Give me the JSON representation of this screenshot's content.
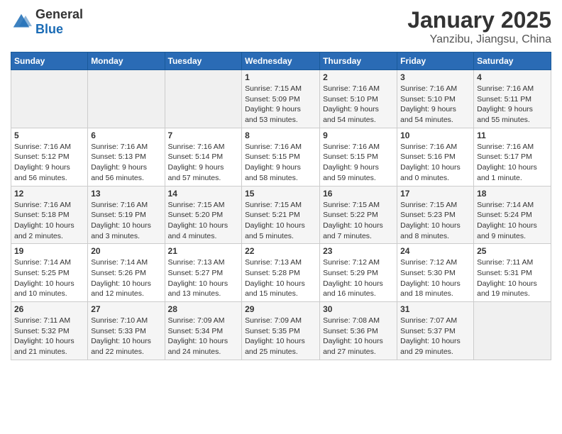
{
  "logo": {
    "general": "General",
    "blue": "Blue"
  },
  "title": "January 2025",
  "location": "Yanzibu, Jiangsu, China",
  "days_of_week": [
    "Sunday",
    "Monday",
    "Tuesday",
    "Wednesday",
    "Thursday",
    "Friday",
    "Saturday"
  ],
  "weeks": [
    [
      {
        "day": "",
        "info": ""
      },
      {
        "day": "",
        "info": ""
      },
      {
        "day": "",
        "info": ""
      },
      {
        "day": "1",
        "info": "Sunrise: 7:15 AM\nSunset: 5:09 PM\nDaylight: 9 hours\nand 53 minutes."
      },
      {
        "day": "2",
        "info": "Sunrise: 7:16 AM\nSunset: 5:10 PM\nDaylight: 9 hours\nand 54 minutes."
      },
      {
        "day": "3",
        "info": "Sunrise: 7:16 AM\nSunset: 5:10 PM\nDaylight: 9 hours\nand 54 minutes."
      },
      {
        "day": "4",
        "info": "Sunrise: 7:16 AM\nSunset: 5:11 PM\nDaylight: 9 hours\nand 55 minutes."
      }
    ],
    [
      {
        "day": "5",
        "info": "Sunrise: 7:16 AM\nSunset: 5:12 PM\nDaylight: 9 hours\nand 56 minutes."
      },
      {
        "day": "6",
        "info": "Sunrise: 7:16 AM\nSunset: 5:13 PM\nDaylight: 9 hours\nand 56 minutes."
      },
      {
        "day": "7",
        "info": "Sunrise: 7:16 AM\nSunset: 5:14 PM\nDaylight: 9 hours\nand 57 minutes."
      },
      {
        "day": "8",
        "info": "Sunrise: 7:16 AM\nSunset: 5:15 PM\nDaylight: 9 hours\nand 58 minutes."
      },
      {
        "day": "9",
        "info": "Sunrise: 7:16 AM\nSunset: 5:15 PM\nDaylight: 9 hours\nand 59 minutes."
      },
      {
        "day": "10",
        "info": "Sunrise: 7:16 AM\nSunset: 5:16 PM\nDaylight: 10 hours\nand 0 minutes."
      },
      {
        "day": "11",
        "info": "Sunrise: 7:16 AM\nSunset: 5:17 PM\nDaylight: 10 hours\nand 1 minute."
      }
    ],
    [
      {
        "day": "12",
        "info": "Sunrise: 7:16 AM\nSunset: 5:18 PM\nDaylight: 10 hours\nand 2 minutes."
      },
      {
        "day": "13",
        "info": "Sunrise: 7:16 AM\nSunset: 5:19 PM\nDaylight: 10 hours\nand 3 minutes."
      },
      {
        "day": "14",
        "info": "Sunrise: 7:15 AM\nSunset: 5:20 PM\nDaylight: 10 hours\nand 4 minutes."
      },
      {
        "day": "15",
        "info": "Sunrise: 7:15 AM\nSunset: 5:21 PM\nDaylight: 10 hours\nand 5 minutes."
      },
      {
        "day": "16",
        "info": "Sunrise: 7:15 AM\nSunset: 5:22 PM\nDaylight: 10 hours\nand 7 minutes."
      },
      {
        "day": "17",
        "info": "Sunrise: 7:15 AM\nSunset: 5:23 PM\nDaylight: 10 hours\nand 8 minutes."
      },
      {
        "day": "18",
        "info": "Sunrise: 7:14 AM\nSunset: 5:24 PM\nDaylight: 10 hours\nand 9 minutes."
      }
    ],
    [
      {
        "day": "19",
        "info": "Sunrise: 7:14 AM\nSunset: 5:25 PM\nDaylight: 10 hours\nand 10 minutes."
      },
      {
        "day": "20",
        "info": "Sunrise: 7:14 AM\nSunset: 5:26 PM\nDaylight: 10 hours\nand 12 minutes."
      },
      {
        "day": "21",
        "info": "Sunrise: 7:13 AM\nSunset: 5:27 PM\nDaylight: 10 hours\nand 13 minutes."
      },
      {
        "day": "22",
        "info": "Sunrise: 7:13 AM\nSunset: 5:28 PM\nDaylight: 10 hours\nand 15 minutes."
      },
      {
        "day": "23",
        "info": "Sunrise: 7:12 AM\nSunset: 5:29 PM\nDaylight: 10 hours\nand 16 minutes."
      },
      {
        "day": "24",
        "info": "Sunrise: 7:12 AM\nSunset: 5:30 PM\nDaylight: 10 hours\nand 18 minutes."
      },
      {
        "day": "25",
        "info": "Sunrise: 7:11 AM\nSunset: 5:31 PM\nDaylight: 10 hours\nand 19 minutes."
      }
    ],
    [
      {
        "day": "26",
        "info": "Sunrise: 7:11 AM\nSunset: 5:32 PM\nDaylight: 10 hours\nand 21 minutes."
      },
      {
        "day": "27",
        "info": "Sunrise: 7:10 AM\nSunset: 5:33 PM\nDaylight: 10 hours\nand 22 minutes."
      },
      {
        "day": "28",
        "info": "Sunrise: 7:09 AM\nSunset: 5:34 PM\nDaylight: 10 hours\nand 24 minutes."
      },
      {
        "day": "29",
        "info": "Sunrise: 7:09 AM\nSunset: 5:35 PM\nDaylight: 10 hours\nand 25 minutes."
      },
      {
        "day": "30",
        "info": "Sunrise: 7:08 AM\nSunset: 5:36 PM\nDaylight: 10 hours\nand 27 minutes."
      },
      {
        "day": "31",
        "info": "Sunrise: 7:07 AM\nSunset: 5:37 PM\nDaylight: 10 hours\nand 29 minutes."
      },
      {
        "day": "",
        "info": ""
      }
    ]
  ]
}
